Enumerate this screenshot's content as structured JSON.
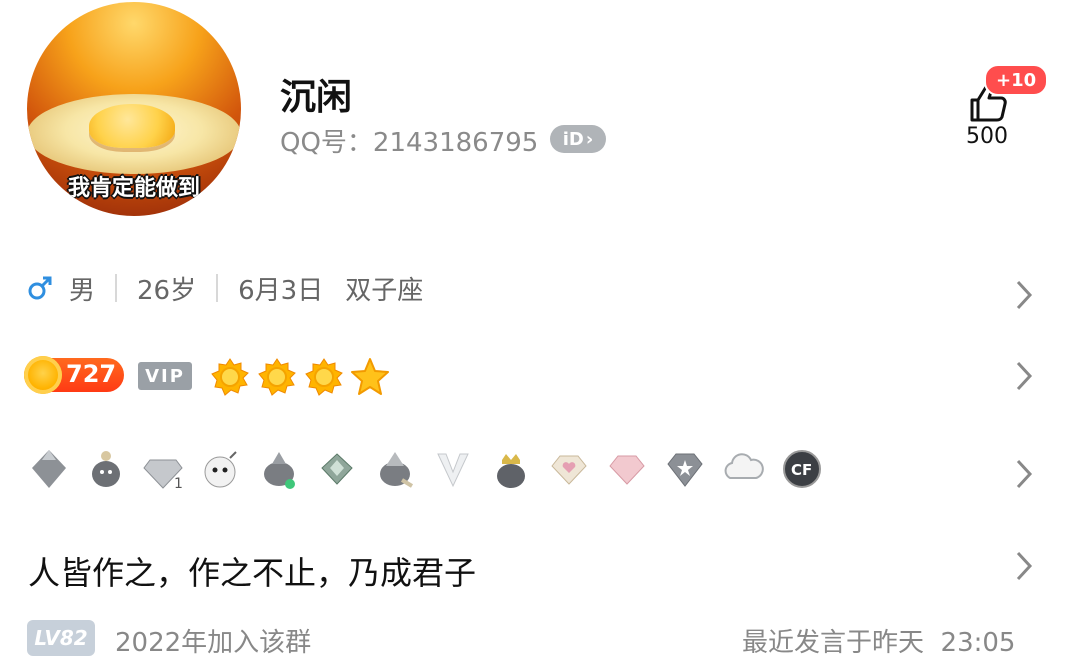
{
  "profile": {
    "avatar_caption": "我肯定能做到",
    "name": "沉闲",
    "qq_label": "QQ号：2143186795",
    "id_badge": "iD",
    "like_badge": "+10",
    "like_count": "500"
  },
  "info": {
    "gender": "男",
    "age": "26岁",
    "birthday": "6月3日",
    "zodiac": "双子座"
  },
  "vip": {
    "coin_level": "727",
    "vip_label": "VIP",
    "suns": 3,
    "stars": 1
  },
  "badges": [
    "gray-bird-badge-icon",
    "penguin-hat-badge-icon",
    "diamond-1-badge-icon",
    "bomb-face-badge-icon",
    "penguin-green-badge-icon",
    "green-diamond-badge-icon",
    "penguin-gray-badge-icon",
    "white-v-badge-icon",
    "crown-penguin-badge-icon",
    "pink-heart-diamond-badge-icon",
    "pink-diamond-badge-icon",
    "gray-diamond-star-badge-icon",
    "cloud-badge-icon",
    "cf-badge-icon"
  ],
  "signature": "人皆作之，作之不止，乃成君子",
  "footer": {
    "level": "LV82",
    "join_text": "2022年加入该群",
    "last_spoke": "最近发言于昨天  23:05"
  },
  "colors": {
    "like_badge": "#ff4d4d",
    "coin_badge": "#ff4a1a",
    "gender_male": "#2f8fe0",
    "secondary_text": "#888888"
  }
}
